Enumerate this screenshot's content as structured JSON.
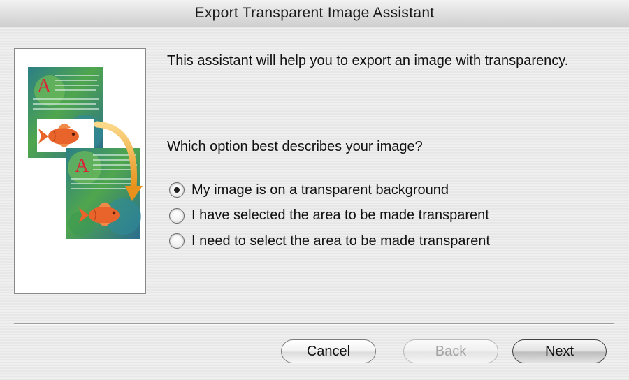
{
  "window": {
    "title": "Export Transparent Image Assistant"
  },
  "intro_text": "This assistant will help you to export an image with transparency.",
  "question": "Which option best describes your image?",
  "options": [
    {
      "label": "My image is on a transparent background",
      "selected": true
    },
    {
      "label": "I have selected the area to be made transparent",
      "selected": false
    },
    {
      "label": "I need to select the area to be made transparent",
      "selected": false
    }
  ],
  "illustration": {
    "page_letter": "A",
    "icons": [
      "page-icon",
      "fish-icon",
      "curved-arrow-icon"
    ]
  },
  "buttons": {
    "cancel": "Cancel",
    "back": "Back",
    "next": "Next",
    "back_enabled": false,
    "default_button": "next"
  },
  "colors": {
    "accent_arrow": "#f0a030",
    "fish": "#e8642a",
    "letter": "#d8263a",
    "page_green": "#3f9a4a",
    "page_teal": "#2b7e8a"
  }
}
